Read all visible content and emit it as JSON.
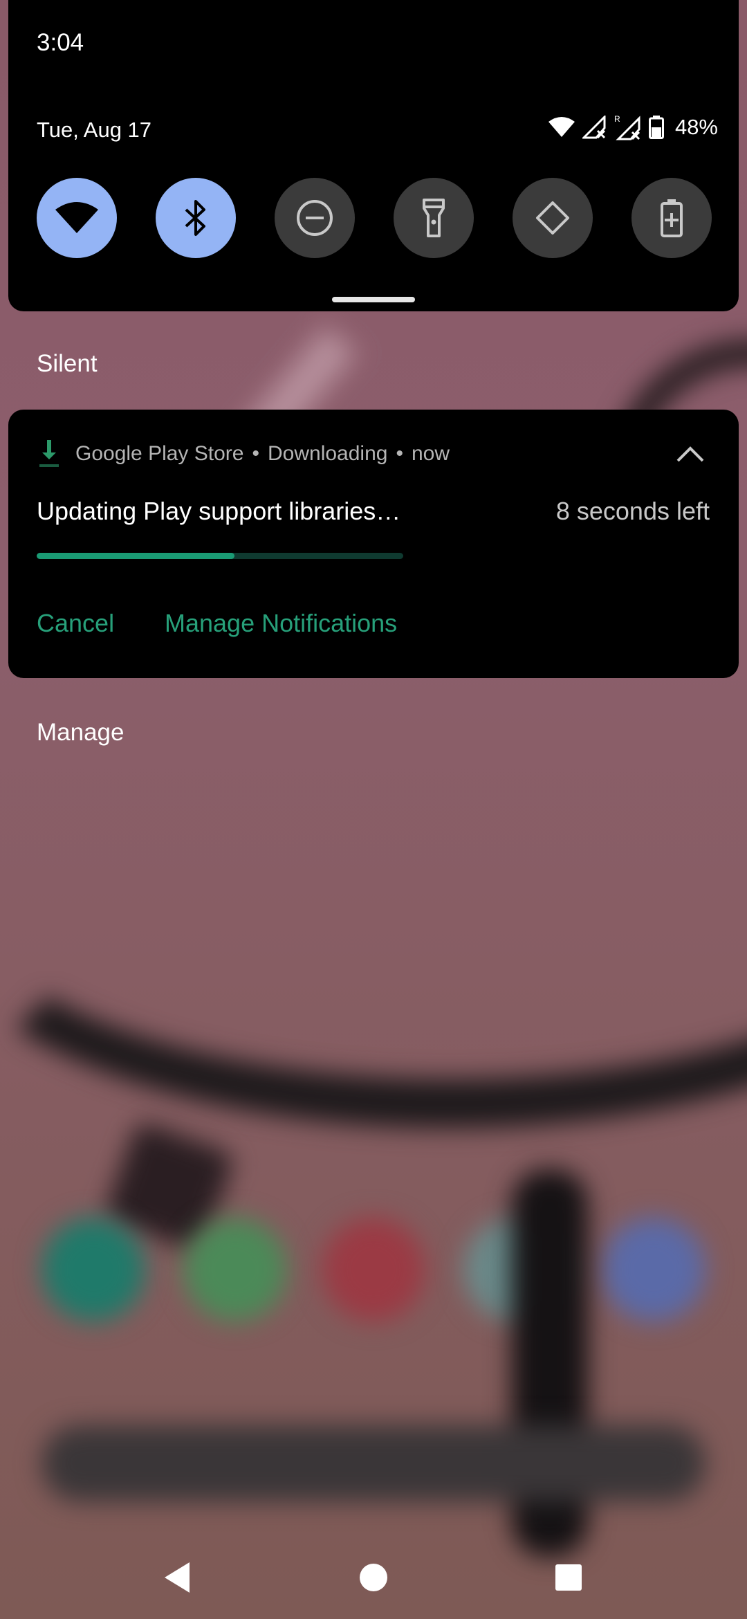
{
  "status_bar": {
    "time": "3:04",
    "date": "Tue, Aug 17",
    "battery": "48%",
    "icons": [
      "wifi-icon",
      "signal-x-icon",
      "roaming-signal-x-icon",
      "battery-icon"
    ]
  },
  "quick_settings": {
    "tiles": [
      {
        "name": "wifi",
        "icon": "wifi-icon",
        "active": true
      },
      {
        "name": "bluetooth",
        "icon": "bluetooth-icon",
        "active": true
      },
      {
        "name": "do-not-disturb",
        "icon": "do-not-disturb-icon",
        "active": false
      },
      {
        "name": "flashlight",
        "icon": "flashlight-icon",
        "active": false
      },
      {
        "name": "auto-rotate",
        "icon": "auto-rotate-icon",
        "active": false
      },
      {
        "name": "battery-saver",
        "icon": "battery-saver-icon",
        "active": false
      }
    ]
  },
  "sections": {
    "silent_label": "Silent",
    "manage_label": "Manage"
  },
  "notification": {
    "app_name": "Google Play Store",
    "separator": "•",
    "category": "Downloading",
    "when": "now",
    "title": "Updating Play support libraries…",
    "time_left": "8 seconds left",
    "progress_percent": 54,
    "actions": {
      "cancel": "Cancel",
      "manage": "Manage Notifications"
    }
  },
  "colors": {
    "accent_green": "#27a07a",
    "tile_active": "#94b4f5",
    "tile_inactive": "#3b3b3b"
  },
  "nav": {
    "buttons": [
      "back-icon",
      "home-icon",
      "recents-icon"
    ]
  }
}
